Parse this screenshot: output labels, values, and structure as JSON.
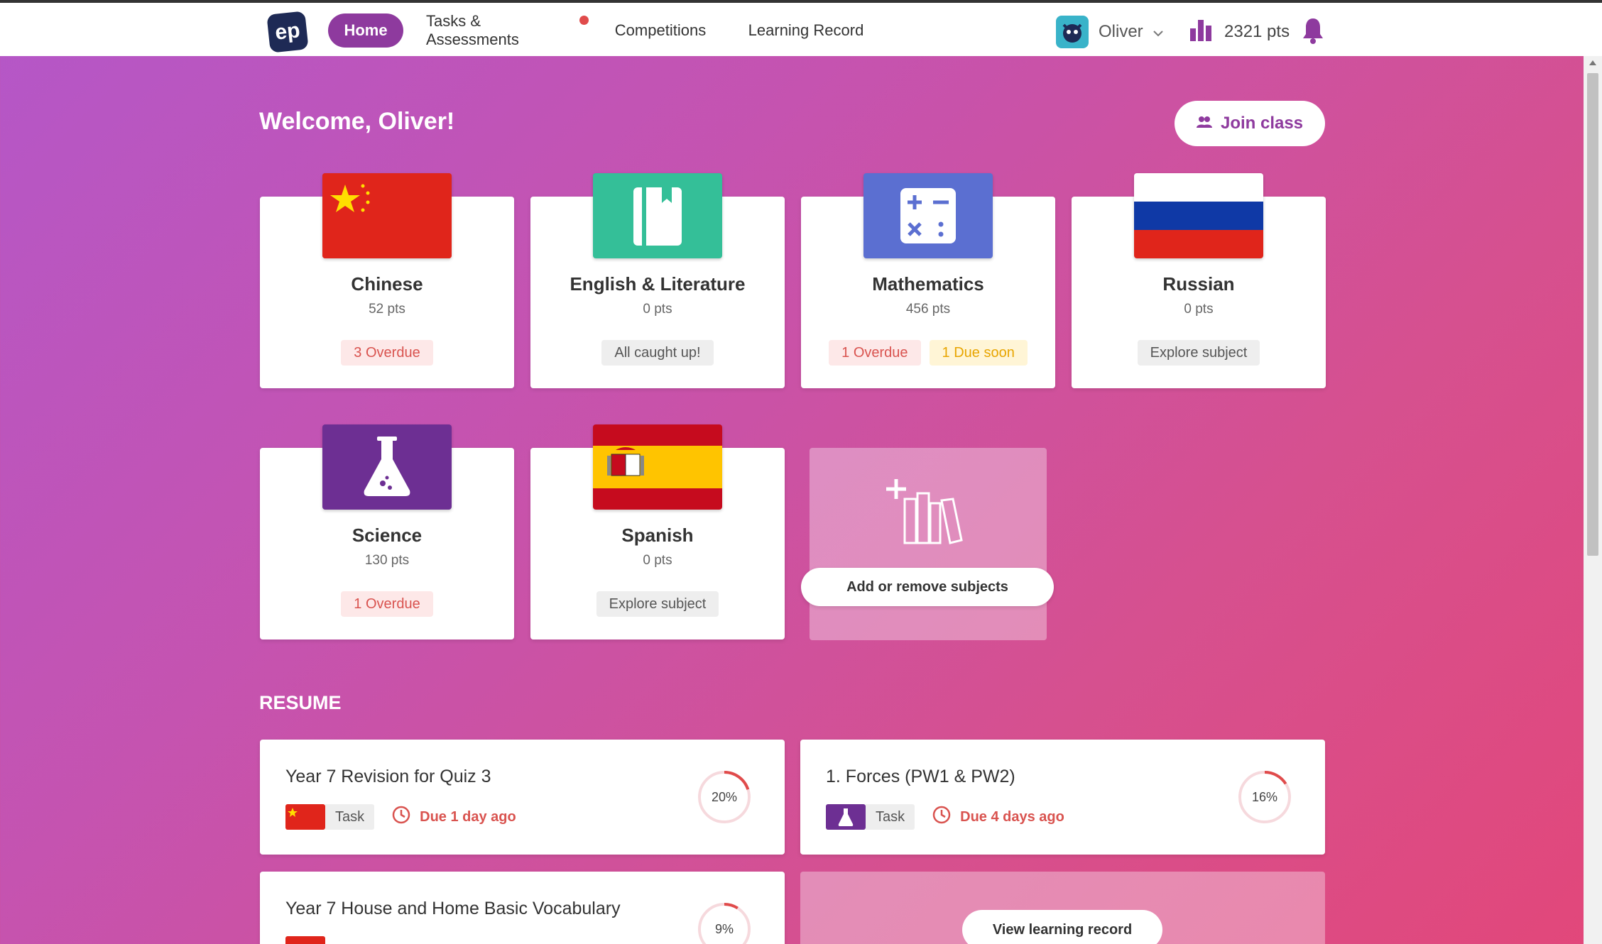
{
  "header": {
    "logo": "ep",
    "nav": [
      {
        "label": "Home"
      },
      {
        "label": "Tasks & Assessments"
      },
      {
        "label": "Competitions"
      },
      {
        "label": "Learning Record"
      }
    ],
    "user_name": "Oliver",
    "points": "2321 pts"
  },
  "welcome": "Welcome, Oliver!",
  "join_class": "Join class",
  "subjects": [
    {
      "name": "Chinese",
      "pts": "52 pts",
      "badges": [
        {
          "text": "3 Overdue"
        }
      ]
    },
    {
      "name": "English & Literature",
      "pts": "0 pts",
      "badges": [
        {
          "text": "All caught up!"
        }
      ]
    },
    {
      "name": "Mathematics",
      "pts": "456 pts",
      "badges": [
        {
          "text": "1 Overdue"
        },
        {
          "text": "1 Due soon"
        }
      ]
    },
    {
      "name": "Russian",
      "pts": "0 pts",
      "badges": [
        {
          "text": "Explore subject"
        }
      ]
    },
    {
      "name": "Science",
      "pts": "130 pts",
      "badges": [
        {
          "text": "1 Overdue"
        }
      ]
    },
    {
      "name": "Spanish",
      "pts": "0 pts",
      "badges": [
        {
          "text": "Explore subject"
        }
      ]
    }
  ],
  "add_subjects": "Add or remove subjects",
  "resume": {
    "title": "RESUME",
    "items": [
      {
        "title": "Year 7 Revision for Quiz 3",
        "type": "Task",
        "due": "Due 1 day ago",
        "progress_label": "20%",
        "progress": 0.2
      },
      {
        "title": "1. Forces (PW1 & PW2)",
        "type": "Task",
        "due": "Due 4 days ago",
        "progress_label": "16%",
        "progress": 0.16
      },
      {
        "title": "Year 7 House and Home Basic Vocabulary",
        "progress_label": "9%",
        "progress": 0.09
      }
    ],
    "view_learning_record": "View learning record"
  },
  "colors": {
    "accent": "#8e3a9e",
    "overdue": "#d9534f",
    "due_soon": "#e8a500",
    "english": "#34bf98",
    "maths": "#5b6fd1",
    "science": "#6d2f93"
  }
}
